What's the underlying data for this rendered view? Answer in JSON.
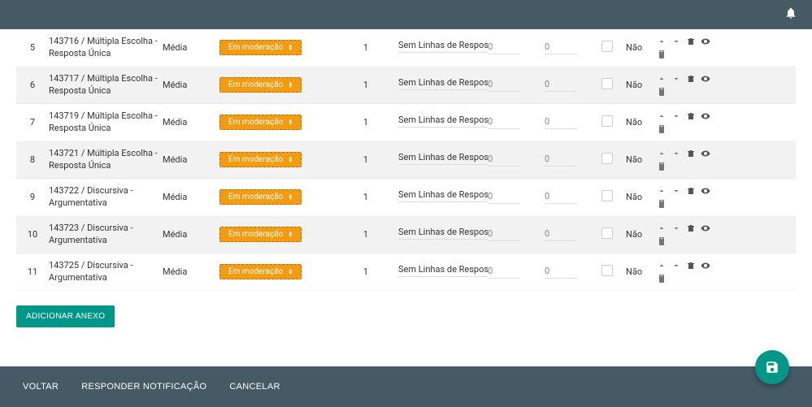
{
  "top": {
    "notifications_icon": "bell"
  },
  "rows": [
    {
      "num": "5",
      "desc": "143716 / Múltipla Escolha - Resposta Única",
      "media": "Média",
      "mod": "Em moderação",
      "one": "1",
      "sem": "Sem Linhas de Respos",
      "z1": "0",
      "z2": "0",
      "nao": "Não"
    },
    {
      "num": "6",
      "desc": "143717 / Múltipla Escolha - Resposta Única",
      "media": "Média",
      "mod": "Em moderação",
      "one": "1",
      "sem": "Sem Linhas de Respos",
      "z1": "0",
      "z2": "0",
      "nao": "Não"
    },
    {
      "num": "7",
      "desc": "143719 / Múltipla Escolha - Resposta Única",
      "media": "Média",
      "mod": "Em moderação",
      "one": "1",
      "sem": "Sem Linhas de Respos",
      "z1": "0",
      "z2": "0",
      "nao": "Não"
    },
    {
      "num": "8",
      "desc": "143721 / Múltipla Escolha - Resposta Única",
      "media": "Média",
      "mod": "Em moderação",
      "one": "1",
      "sem": "Sem Linhas de Respos",
      "z1": "0",
      "z2": "0",
      "nao": "Não"
    },
    {
      "num": "9",
      "desc": "143722 / Discursiva - Argumentativa",
      "media": "Média",
      "mod": "Em moderação",
      "one": "1",
      "sem": "Sem Linhas de Respos",
      "z1": "0",
      "z2": "0",
      "nao": "Não"
    },
    {
      "num": "10",
      "desc": "143723 / Discursiva - Argumentativa",
      "media": "Média",
      "mod": "Em moderação",
      "one": "1",
      "sem": "Sem Linhas de Respos",
      "z1": "0",
      "z2": "0",
      "nao": "Não"
    },
    {
      "num": "11",
      "desc": "143725 / Discursiva - Argumentativa",
      "media": "Média",
      "mod": "Em moderação",
      "one": "1",
      "sem": "Sem Linhas de Respos",
      "z1": "0",
      "z2": "0",
      "nao": "Não"
    }
  ],
  "buttons": {
    "add_anexo": "ADICIONAR ANEXO",
    "voltar": "VOLTAR",
    "responder": "RESPONDER NOTIFICAÇÃO",
    "cancelar": "CANCELAR"
  },
  "colors": {
    "teal": "#009688",
    "header": "#455a64",
    "orange": "#f39c12"
  }
}
